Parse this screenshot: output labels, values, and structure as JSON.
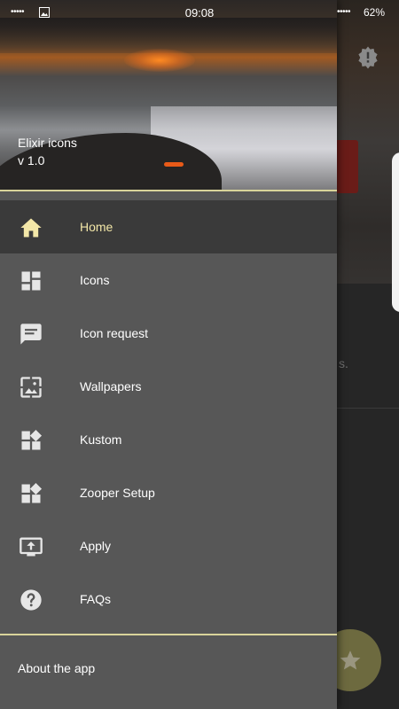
{
  "status_bar": {
    "signal_left": "•••••",
    "time": "09:08",
    "signal_right": "•••••",
    "battery": "62%"
  },
  "drawer": {
    "header": {
      "title": "Elixir icons",
      "version": "v 1.0"
    },
    "items": [
      {
        "label": "Home",
        "icon": "home-icon",
        "active": true
      },
      {
        "label": "Icons",
        "icon": "dashboard-icon",
        "active": false
      },
      {
        "label": "Icon request",
        "icon": "chat-bubble-icon",
        "active": false
      },
      {
        "label": "Wallpapers",
        "icon": "wallpaper-icon",
        "active": false
      },
      {
        "label": "Kustom",
        "icon": "widgets-icon",
        "active": false
      },
      {
        "label": "Zooper Setup",
        "icon": "widgets-icon",
        "active": false
      },
      {
        "label": "Apply",
        "icon": "apply-icon",
        "active": false
      },
      {
        "label": "FAQs",
        "icon": "help-circle-icon",
        "active": false
      }
    ],
    "footer": {
      "about_label": "About the app"
    }
  },
  "background": {
    "text_fragment": "s."
  },
  "colors": {
    "drawer_bg": "#575757",
    "active_item_bg": "#3a3a3a",
    "accent": "#f3e7a8",
    "divider_accent": "#d9d49a",
    "fab": "#6d6a3f"
  }
}
